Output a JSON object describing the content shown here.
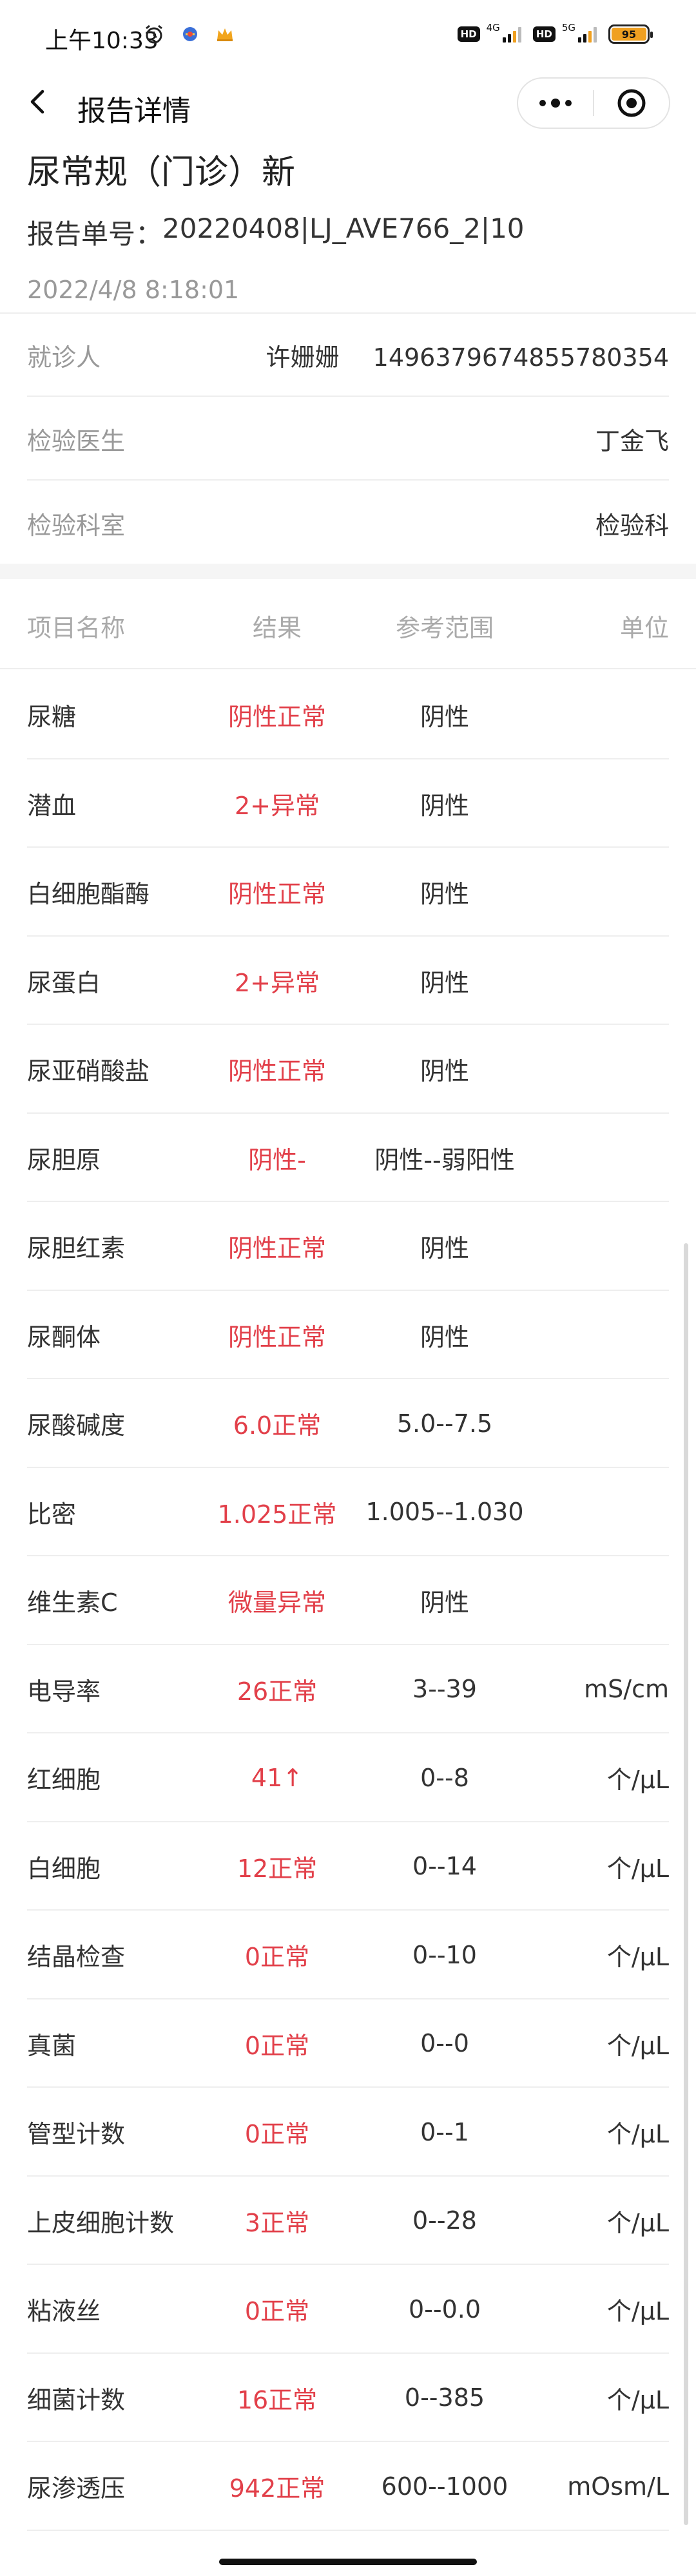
{
  "status_bar": {
    "time": "上午10:33",
    "battery": "95",
    "net1": "4G",
    "net2": "5G",
    "hd": "HD"
  },
  "nav": {
    "title": "报告详情"
  },
  "report": {
    "title": "尿常规（门诊）新",
    "number_label": "报告单号：",
    "number": "20220408|LJ_AVE766_2|10",
    "time": "2022/4/8 8:18:01"
  },
  "info": {
    "patient_label": "就诊人",
    "patient_name": "许姗姗",
    "patient_id": "1496379674855780354",
    "doctor_label": "检验医生",
    "doctor": "丁金飞",
    "dept_label": "检验科室",
    "dept": "检验科"
  },
  "table": {
    "headers": {
      "name": "项目名称",
      "result": "结果",
      "range": "参考范围",
      "unit": "单位"
    },
    "rows": [
      {
        "name": "尿糖",
        "result": "阴性正常",
        "range": "阴性",
        "unit": ""
      },
      {
        "name": "潜血",
        "result": "2+异常",
        "range": "阴性",
        "unit": ""
      },
      {
        "name": "白细胞酯酶",
        "result": "阴性正常",
        "range": "阴性",
        "unit": ""
      },
      {
        "name": "尿蛋白",
        "result": "2+异常",
        "range": "阴性",
        "unit": ""
      },
      {
        "name": "尿亚硝酸盐",
        "result": "阴性正常",
        "range": "阴性",
        "unit": ""
      },
      {
        "name": "尿胆原",
        "result": "阴性-",
        "range": "阴性--弱阳性",
        "unit": ""
      },
      {
        "name": "尿胆红素",
        "result": "阴性正常",
        "range": "阴性",
        "unit": ""
      },
      {
        "name": "尿酮体",
        "result": "阴性正常",
        "range": "阴性",
        "unit": ""
      },
      {
        "name": "尿酸碱度",
        "result": "6.0正常",
        "range": "5.0--7.5",
        "unit": ""
      },
      {
        "name": "比密",
        "result": "1.025正常",
        "range": "1.005--1.030",
        "unit": ""
      },
      {
        "name": "维生素C",
        "result": "微量异常",
        "range": "阴性",
        "unit": ""
      },
      {
        "name": "电导率",
        "result": "26正常",
        "range": "3--39",
        "unit": "mS/cm"
      },
      {
        "name": "红细胞",
        "result": "41↑",
        "range": "0--8",
        "unit": "个/μL"
      },
      {
        "name": "白细胞",
        "result": "12正常",
        "range": "0--14",
        "unit": "个/μL"
      },
      {
        "name": "结晶检查",
        "result": "0正常",
        "range": "0--10",
        "unit": "个/μL"
      },
      {
        "name": "真菌",
        "result": "0正常",
        "range": "0--0",
        "unit": "个/μL"
      },
      {
        "name": "管型计数",
        "result": "0正常",
        "range": "0--1",
        "unit": "个/μL"
      },
      {
        "name": "上皮细胞计数",
        "result": "3正常",
        "range": "0--28",
        "unit": "个/μL"
      },
      {
        "name": "粘液丝",
        "result": "0正常",
        "range": "0--0.0",
        "unit": "个/μL"
      },
      {
        "name": "细菌计数",
        "result": "16正常",
        "range": "0--385",
        "unit": "个/μL"
      },
      {
        "name": "尿渗透压",
        "result": "942正常",
        "range": "600--1000",
        "unit": "mOsm/L"
      }
    ]
  },
  "colors": {
    "result_red": "#e2404a",
    "label_gray": "#999999",
    "divider": "#eeeeee"
  },
  "icons": {
    "back": "chevron-left-icon",
    "more": "more-dots-icon",
    "close": "target-close-icon"
  }
}
